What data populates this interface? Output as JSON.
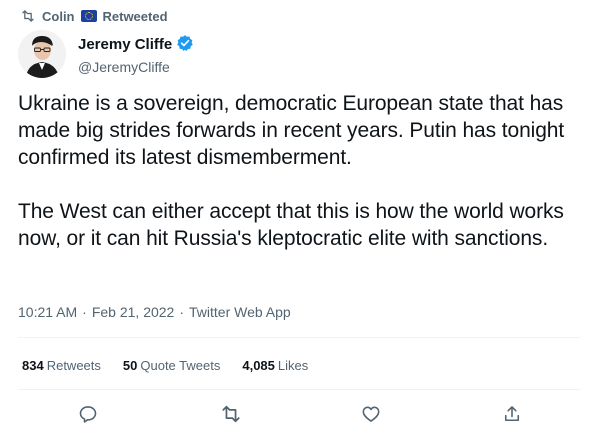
{
  "retweet": {
    "name": "Colin",
    "label": "Retweeted"
  },
  "author": {
    "display_name": "Jeremy Cliffe",
    "handle": "@JeremyCliffe"
  },
  "tweet": {
    "paragraphs": [
      "Ukraine is a sovereign, democratic European state that has made big strides forwards in recent years. Putin has tonight confirmed its latest dismemberment.",
      "The West can either accept that this is how the world works now, or it can hit Russia's kleptocratic elite with sanctions."
    ]
  },
  "meta": {
    "time": "10:21 AM",
    "date": "Feb 21, 2022",
    "source": "Twitter Web App",
    "separator": "·"
  },
  "stats": {
    "retweets": {
      "count": "834",
      "label": "Retweets"
    },
    "quotes": {
      "count": "50",
      "label": "Quote Tweets"
    },
    "likes": {
      "count": "4,085",
      "label": "Likes"
    }
  },
  "actions": [
    "reply-icon",
    "retweet-icon",
    "like-icon",
    "share-icon"
  ],
  "colors": {
    "text": "#0f1419",
    "secondary": "#536471",
    "verified": "#1d9bf0",
    "divider": "#eff3f4"
  }
}
